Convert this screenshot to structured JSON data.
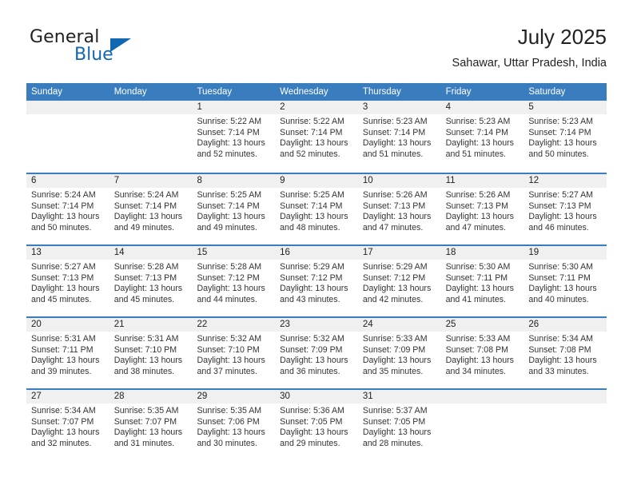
{
  "brand": {
    "name_primary": "General",
    "name_secondary": "Blue",
    "accent_color": "#1267b2",
    "triangle_icon": "triangle-icon"
  },
  "header": {
    "title": "July 2025",
    "subtitle": "Sahawar, Uttar Pradesh, India"
  },
  "theme": {
    "header_row_color": "#3a7dbf",
    "date_band_color": "#f0f0f0",
    "text_color": "#222222"
  },
  "calendar": {
    "day_headers": [
      "Sunday",
      "Monday",
      "Tuesday",
      "Wednesday",
      "Thursday",
      "Friday",
      "Saturday"
    ],
    "weeks": [
      [
        {
          "day": "",
          "sunrise": "",
          "sunset": "",
          "daylight": ""
        },
        {
          "day": "",
          "sunrise": "",
          "sunset": "",
          "daylight": ""
        },
        {
          "day": "1",
          "sunrise": "Sunrise: 5:22 AM",
          "sunset": "Sunset: 7:14 PM",
          "daylight": "Daylight: 13 hours and 52 minutes."
        },
        {
          "day": "2",
          "sunrise": "Sunrise: 5:22 AM",
          "sunset": "Sunset: 7:14 PM",
          "daylight": "Daylight: 13 hours and 52 minutes."
        },
        {
          "day": "3",
          "sunrise": "Sunrise: 5:23 AM",
          "sunset": "Sunset: 7:14 PM",
          "daylight": "Daylight: 13 hours and 51 minutes."
        },
        {
          "day": "4",
          "sunrise": "Sunrise: 5:23 AM",
          "sunset": "Sunset: 7:14 PM",
          "daylight": "Daylight: 13 hours and 51 minutes."
        },
        {
          "day": "5",
          "sunrise": "Sunrise: 5:23 AM",
          "sunset": "Sunset: 7:14 PM",
          "daylight": "Daylight: 13 hours and 50 minutes."
        }
      ],
      [
        {
          "day": "6",
          "sunrise": "Sunrise: 5:24 AM",
          "sunset": "Sunset: 7:14 PM",
          "daylight": "Daylight: 13 hours and 50 minutes."
        },
        {
          "day": "7",
          "sunrise": "Sunrise: 5:24 AM",
          "sunset": "Sunset: 7:14 PM",
          "daylight": "Daylight: 13 hours and 49 minutes."
        },
        {
          "day": "8",
          "sunrise": "Sunrise: 5:25 AM",
          "sunset": "Sunset: 7:14 PM",
          "daylight": "Daylight: 13 hours and 49 minutes."
        },
        {
          "day": "9",
          "sunrise": "Sunrise: 5:25 AM",
          "sunset": "Sunset: 7:14 PM",
          "daylight": "Daylight: 13 hours and 48 minutes."
        },
        {
          "day": "10",
          "sunrise": "Sunrise: 5:26 AM",
          "sunset": "Sunset: 7:13 PM",
          "daylight": "Daylight: 13 hours and 47 minutes."
        },
        {
          "day": "11",
          "sunrise": "Sunrise: 5:26 AM",
          "sunset": "Sunset: 7:13 PM",
          "daylight": "Daylight: 13 hours and 47 minutes."
        },
        {
          "day": "12",
          "sunrise": "Sunrise: 5:27 AM",
          "sunset": "Sunset: 7:13 PM",
          "daylight": "Daylight: 13 hours and 46 minutes."
        }
      ],
      [
        {
          "day": "13",
          "sunrise": "Sunrise: 5:27 AM",
          "sunset": "Sunset: 7:13 PM",
          "daylight": "Daylight: 13 hours and 45 minutes."
        },
        {
          "day": "14",
          "sunrise": "Sunrise: 5:28 AM",
          "sunset": "Sunset: 7:13 PM",
          "daylight": "Daylight: 13 hours and 45 minutes."
        },
        {
          "day": "15",
          "sunrise": "Sunrise: 5:28 AM",
          "sunset": "Sunset: 7:12 PM",
          "daylight": "Daylight: 13 hours and 44 minutes."
        },
        {
          "day": "16",
          "sunrise": "Sunrise: 5:29 AM",
          "sunset": "Sunset: 7:12 PM",
          "daylight": "Daylight: 13 hours and 43 minutes."
        },
        {
          "day": "17",
          "sunrise": "Sunrise: 5:29 AM",
          "sunset": "Sunset: 7:12 PM",
          "daylight": "Daylight: 13 hours and 42 minutes."
        },
        {
          "day": "18",
          "sunrise": "Sunrise: 5:30 AM",
          "sunset": "Sunset: 7:11 PM",
          "daylight": "Daylight: 13 hours and 41 minutes."
        },
        {
          "day": "19",
          "sunrise": "Sunrise: 5:30 AM",
          "sunset": "Sunset: 7:11 PM",
          "daylight": "Daylight: 13 hours and 40 minutes."
        }
      ],
      [
        {
          "day": "20",
          "sunrise": "Sunrise: 5:31 AM",
          "sunset": "Sunset: 7:11 PM",
          "daylight": "Daylight: 13 hours and 39 minutes."
        },
        {
          "day": "21",
          "sunrise": "Sunrise: 5:31 AM",
          "sunset": "Sunset: 7:10 PM",
          "daylight": "Daylight: 13 hours and 38 minutes."
        },
        {
          "day": "22",
          "sunrise": "Sunrise: 5:32 AM",
          "sunset": "Sunset: 7:10 PM",
          "daylight": "Daylight: 13 hours and 37 minutes."
        },
        {
          "day": "23",
          "sunrise": "Sunrise: 5:32 AM",
          "sunset": "Sunset: 7:09 PM",
          "daylight": "Daylight: 13 hours and 36 minutes."
        },
        {
          "day": "24",
          "sunrise": "Sunrise: 5:33 AM",
          "sunset": "Sunset: 7:09 PM",
          "daylight": "Daylight: 13 hours and 35 minutes."
        },
        {
          "day": "25",
          "sunrise": "Sunrise: 5:33 AM",
          "sunset": "Sunset: 7:08 PM",
          "daylight": "Daylight: 13 hours and 34 minutes."
        },
        {
          "day": "26",
          "sunrise": "Sunrise: 5:34 AM",
          "sunset": "Sunset: 7:08 PM",
          "daylight": "Daylight: 13 hours and 33 minutes."
        }
      ],
      [
        {
          "day": "27",
          "sunrise": "Sunrise: 5:34 AM",
          "sunset": "Sunset: 7:07 PM",
          "daylight": "Daylight: 13 hours and 32 minutes."
        },
        {
          "day": "28",
          "sunrise": "Sunrise: 5:35 AM",
          "sunset": "Sunset: 7:07 PM",
          "daylight": "Daylight: 13 hours and 31 minutes."
        },
        {
          "day": "29",
          "sunrise": "Sunrise: 5:35 AM",
          "sunset": "Sunset: 7:06 PM",
          "daylight": "Daylight: 13 hours and 30 minutes."
        },
        {
          "day": "30",
          "sunrise": "Sunrise: 5:36 AM",
          "sunset": "Sunset: 7:05 PM",
          "daylight": "Daylight: 13 hours and 29 minutes."
        },
        {
          "day": "31",
          "sunrise": "Sunrise: 5:37 AM",
          "sunset": "Sunset: 7:05 PM",
          "daylight": "Daylight: 13 hours and 28 minutes."
        },
        {
          "day": "",
          "sunrise": "",
          "sunset": "",
          "daylight": ""
        },
        {
          "day": "",
          "sunrise": "",
          "sunset": "",
          "daylight": ""
        }
      ]
    ]
  }
}
